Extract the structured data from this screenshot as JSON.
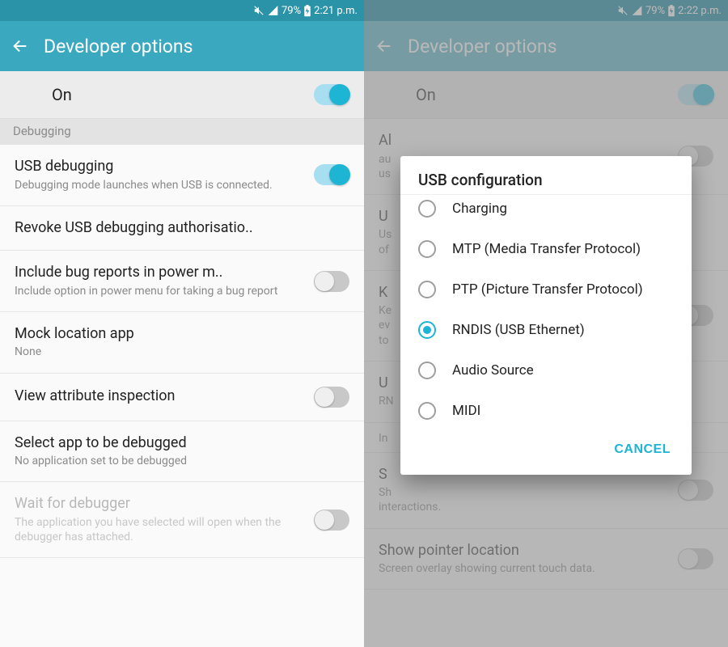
{
  "left": {
    "status": {
      "battery": "79%",
      "time": "2:21 p.m."
    },
    "appbar": {
      "title": "Developer options"
    },
    "master": {
      "label": "On",
      "on": true
    },
    "section": "Debugging",
    "rows": [
      {
        "title": "USB debugging",
        "sub": "Debugging mode launches when USB is connected.",
        "toggle": true,
        "on": true
      },
      {
        "title": "Revoke USB debugging authorisatio.."
      },
      {
        "title": "Include bug reports in power m..",
        "sub": "Include option in power menu for taking a bug report",
        "toggle": true,
        "on": false
      },
      {
        "title": "Mock location app",
        "sub": "None"
      },
      {
        "title": "View attribute inspection",
        "toggle": true,
        "on": false
      },
      {
        "title": "Select app to be debugged",
        "sub": "No application set to be debugged"
      },
      {
        "title": "Wait for debugger",
        "sub": "The application you have selected will open when the debugger has attached.",
        "toggle": true,
        "on": false,
        "disabled": true
      }
    ]
  },
  "right": {
    "status": {
      "battery": "79%",
      "time": "2:22 p.m."
    },
    "appbar": {
      "title": "Developer options"
    },
    "master": {
      "label": "On",
      "on": true
    },
    "bg_rows": [
      {
        "title_frag": "Al",
        "sub_frag": "au\nus"
      },
      {
        "title_frag": "U",
        "sub_frag": "Us\nof"
      },
      {
        "title_frag": "K",
        "sub_frag": "Ke\nev\nto"
      },
      {
        "title_frag": "U",
        "sub_frag_accent": "RN"
      },
      {
        "title_frag": "In"
      },
      {
        "title_frag": "S",
        "sub_frag": "Sh\ninteractions."
      },
      {
        "title": "Show pointer location",
        "sub": "Screen overlay showing current touch data."
      }
    ],
    "dialog": {
      "title": "USB configuration",
      "options": [
        "Charging",
        "MTP (Media Transfer Protocol)",
        "PTP (Picture Transfer Protocol)",
        "RNDIS (USB Ethernet)",
        "Audio Source",
        "MIDI"
      ],
      "selected_index": 3,
      "cancel": "CANCEL"
    }
  }
}
